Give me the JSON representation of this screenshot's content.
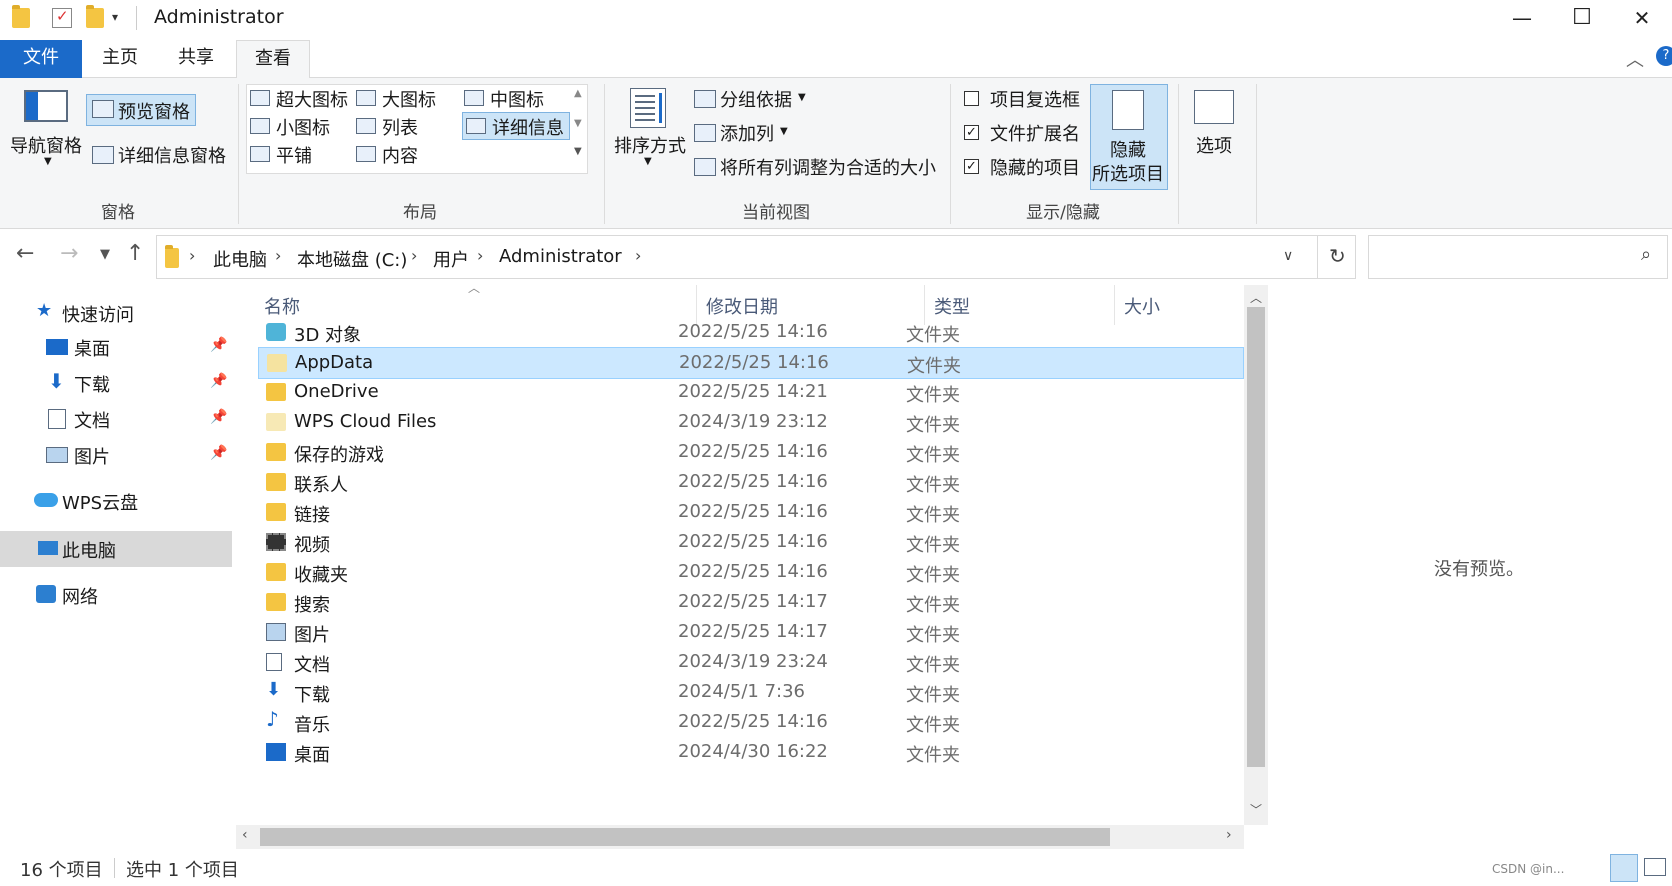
{
  "window": {
    "title": "Administrator",
    "minimize": "—",
    "maximize": "☐",
    "close": "✕"
  },
  "tabs": [
    {
      "label": "文件"
    },
    {
      "label": "主页"
    },
    {
      "label": "共享"
    },
    {
      "label": "查看"
    }
  ],
  "ribbon": {
    "pane": {
      "nav_pane": "导航窗格",
      "preview_pane": "预览窗格",
      "details_pane": "详细信息窗格",
      "group_label": "窗格"
    },
    "layout": {
      "extra_large": "超大图标",
      "large": "大图标",
      "medium": "中图标",
      "small": "小图标",
      "list": "列表",
      "details": "详细信息",
      "tiles": "平铺",
      "content": "内容",
      "group_label": "布局"
    },
    "current_view": {
      "sort": "排序方式",
      "group_by": "分组依据",
      "add_column": "添加列",
      "fit_columns": "将所有列调整为合适的大小",
      "group_label": "当前视图"
    },
    "show_hide": {
      "item_checkboxes": "项目复选框",
      "file_extensions": "文件扩展名",
      "hidden_items": "隐藏的项目",
      "hide_selected_line1": "隐藏",
      "hide_selected_line2": "所选项目",
      "group_label": "显示/隐藏",
      "item_checkboxes_checked": false,
      "file_extensions_checked": true,
      "hidden_items_checked": true
    },
    "options": "选项"
  },
  "address": {
    "crumbs": [
      "此电脑",
      "本地磁盘 (C:)",
      "用户",
      "Administrator"
    ]
  },
  "nav": {
    "quick_access": "快速访问",
    "desktop": "桌面",
    "downloads": "下载",
    "documents": "文档",
    "pictures": "图片",
    "wps_cloud": "WPS云盘",
    "this_pc": "此电脑",
    "network": "网络"
  },
  "columns": {
    "name": "名称",
    "date": "修改日期",
    "type": "类型",
    "size": "大小"
  },
  "files": [
    {
      "name": "3D 对象",
      "date": "2022/5/25 14:16",
      "type": "文件夹",
      "icon": "3d-objects-icon"
    },
    {
      "name": "AppData",
      "date": "2022/5/25 14:16",
      "type": "文件夹",
      "icon": "folder-icon"
    },
    {
      "name": "OneDrive",
      "date": "2022/5/25 14:21",
      "type": "文件夹",
      "icon": "folder-icon"
    },
    {
      "name": "WPS Cloud Files",
      "date": "2024/3/19 23:12",
      "type": "文件夹",
      "icon": "folder-icon"
    },
    {
      "name": "保存的游戏",
      "date": "2022/5/25 14:16",
      "type": "文件夹",
      "icon": "saved-games-icon"
    },
    {
      "name": "联系人",
      "date": "2022/5/25 14:16",
      "type": "文件夹",
      "icon": "contacts-icon"
    },
    {
      "name": "链接",
      "date": "2022/5/25 14:16",
      "type": "文件夹",
      "icon": "links-icon"
    },
    {
      "name": "视频",
      "date": "2022/5/25 14:16",
      "type": "文件夹",
      "icon": "videos-icon"
    },
    {
      "name": "收藏夹",
      "date": "2022/5/25 14:16",
      "type": "文件夹",
      "icon": "favorites-icon"
    },
    {
      "name": "搜索",
      "date": "2022/5/25 14:17",
      "type": "文件夹",
      "icon": "searches-icon"
    },
    {
      "name": "图片",
      "date": "2022/5/25 14:17",
      "type": "文件夹",
      "icon": "pictures-icon"
    },
    {
      "name": "文档",
      "date": "2024/3/19 23:24",
      "type": "文件夹",
      "icon": "documents-icon"
    },
    {
      "name": "下载",
      "date": "2024/5/1 7:36",
      "type": "文件夹",
      "icon": "downloads-icon"
    },
    {
      "name": "音乐",
      "date": "2022/5/25 14:16",
      "type": "文件夹",
      "icon": "music-icon"
    },
    {
      "name": "桌面",
      "date": "2024/4/30 16:22",
      "type": "文件夹",
      "icon": "desktop-icon"
    }
  ],
  "selected_file": "AppData",
  "preview": {
    "text": "没有预览。"
  },
  "status": {
    "count": "16 个项目",
    "selected": "选中 1 个项目",
    "watermark": "CSDN @in..."
  },
  "colors": {
    "accent": "#1b6ac9",
    "selection": "#cce8ff",
    "folder": "#f4c542"
  }
}
